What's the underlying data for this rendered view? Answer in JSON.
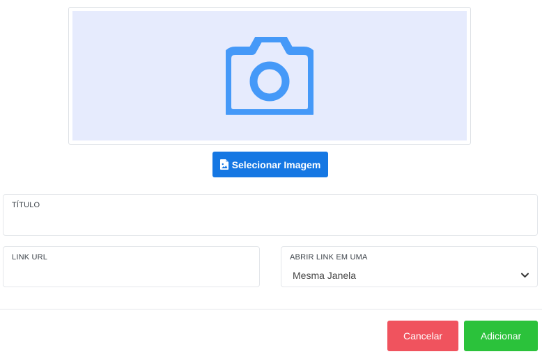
{
  "image_picker": {
    "icon": "camera-icon",
    "button_icon": "file-image-icon",
    "button_label": "Selecionar Imagem"
  },
  "form": {
    "title_field": {
      "label": "TÍTULO",
      "value": ""
    },
    "link_field": {
      "label": "LINK URL",
      "value": ""
    },
    "target_field": {
      "label": "ABRIR LINK EM UMA",
      "selected": "Mesma Janela"
    }
  },
  "actions": {
    "cancel_label": "Cancelar",
    "add_label": "Adicionar"
  },
  "colors": {
    "primary": "#1577e3",
    "preview_bg": "#e6ebfd",
    "icon_blue": "#4599f8",
    "cancel": "#f0535e",
    "add": "#2bc23b"
  }
}
